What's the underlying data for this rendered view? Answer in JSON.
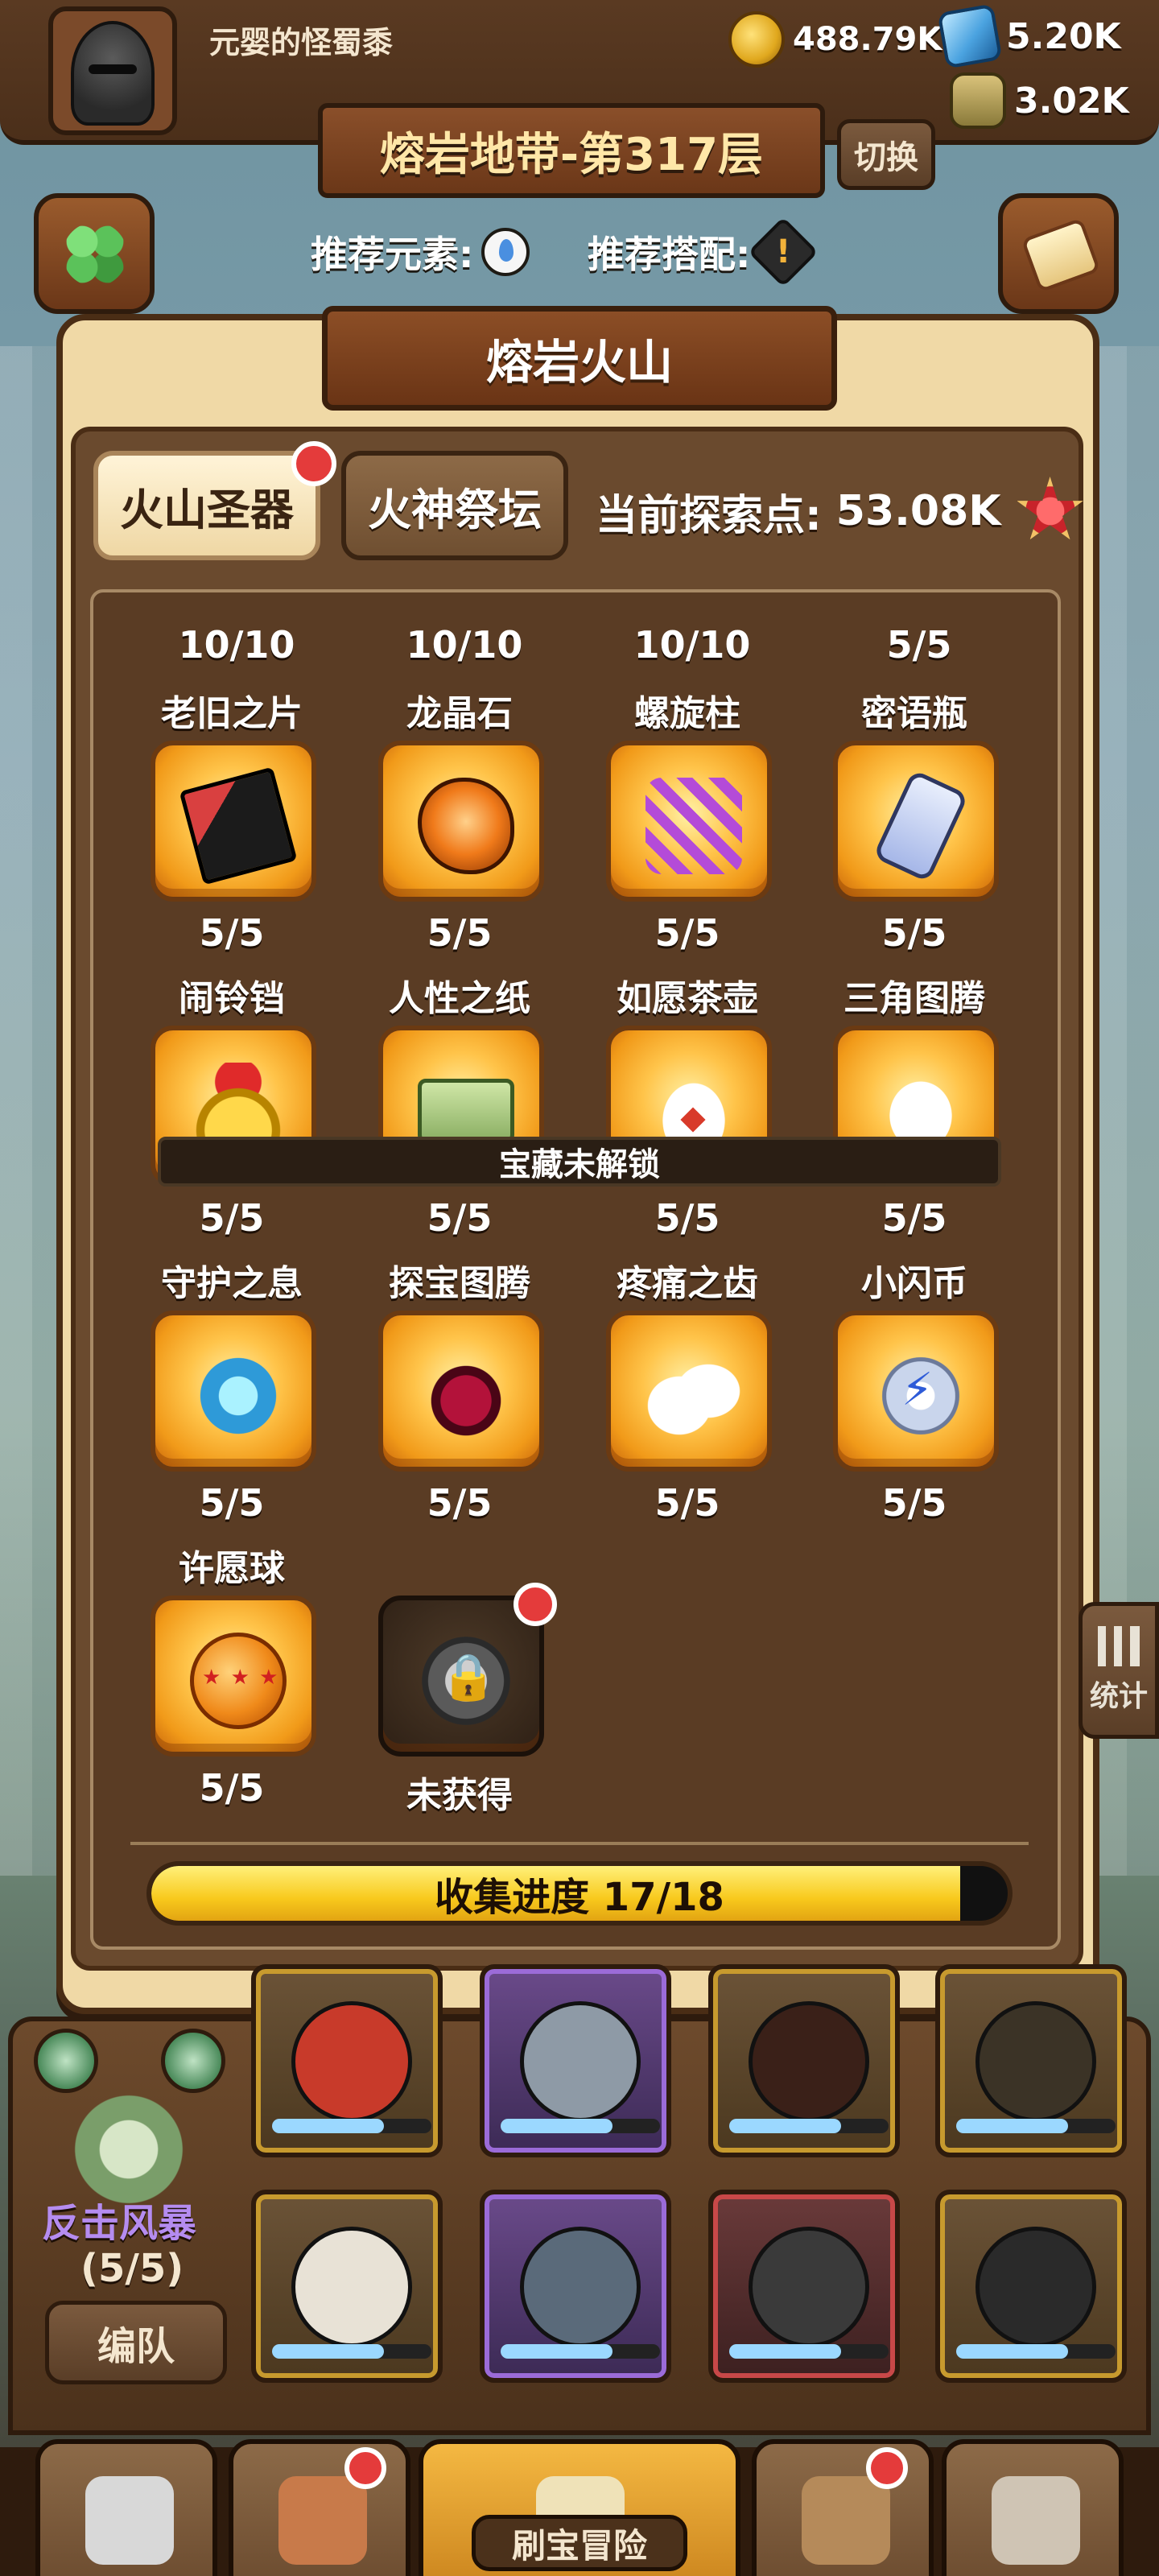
{
  "player": {
    "name": "元婴的怪蜀黍"
  },
  "resources": {
    "gold": "488.79K",
    "gems": "5.20K",
    "jars": "3.02K"
  },
  "level": {
    "title": "熔岩地带-第317层",
    "switch_label": "切换"
  },
  "recommend": {
    "element_label": "推荐元素:",
    "combo_label": "推荐搭配:"
  },
  "dialog": {
    "title": "熔岩火山",
    "tabs": [
      {
        "label": "火山圣器",
        "active": true,
        "has_badge": true
      },
      {
        "label": "火神祭坛",
        "active": false,
        "has_badge": false
      }
    ],
    "explore_label": "当前探索点:",
    "explore_value": "53.08K",
    "top_row_counts": [
      "10/10",
      "10/10",
      "10/10",
      "5/5"
    ],
    "items": [
      {
        "name": "老旧之片",
        "count": "5/5",
        "icon": "card-fragment-icon",
        "locked": false
      },
      {
        "name": "龙晶石",
        "count": "5/5",
        "icon": "dragon-crystal-icon",
        "locked": false
      },
      {
        "name": "螺旋柱",
        "count": "5/5",
        "icon": "helix-icon",
        "locked": false
      },
      {
        "name": "密语瓶",
        "count": "5/5",
        "icon": "bottle-icon",
        "locked": false
      },
      {
        "name": "闹铃铛",
        "count": "5/5",
        "icon": "bell-icon",
        "locked": false
      },
      {
        "name": "人性之纸",
        "count": "5/5",
        "icon": "money-stack-icon",
        "locked": false
      },
      {
        "name": "如愿茶壶",
        "count": "5/5",
        "icon": "teapot-icon",
        "locked": false
      },
      {
        "name": "三角图腾",
        "count": "5/5",
        "icon": "triangle-totem-icon",
        "locked": false
      },
      {
        "name": "守护之息",
        "count": "5/5",
        "icon": "shield-flame-icon",
        "locked": false
      },
      {
        "name": "探宝图腾",
        "count": "5/5",
        "icon": "bomb-orb-icon",
        "locked": false
      },
      {
        "name": "疼痛之齿",
        "count": "5/5",
        "icon": "fang-icon",
        "locked": false
      },
      {
        "name": "小闪币",
        "count": "5/5",
        "icon": "lightning-coin-icon",
        "locked": false
      },
      {
        "name": "许愿球",
        "count": "5/5",
        "icon": "wish-ball-icon",
        "locked": false
      },
      {
        "name": "",
        "count": "未获得",
        "icon": "lock-icon",
        "locked": true
      }
    ],
    "locked_banner": "宝藏未解锁",
    "progress": {
      "label": "收集进度 17/18",
      "value": 17,
      "max": 18
    }
  },
  "side": {
    "stats_label": "统计"
  },
  "team": {
    "skill_title": "反击风暴",
    "skill_progress": "(5/5)",
    "edit_button": "编队"
  },
  "nav": {
    "center_label": "刷宝冒险"
  },
  "colors": {
    "brown_dark": "#2e1b0d",
    "panel": "#5a3c24",
    "gold": "#f8c91c",
    "badge_red": "#e43b3b"
  }
}
